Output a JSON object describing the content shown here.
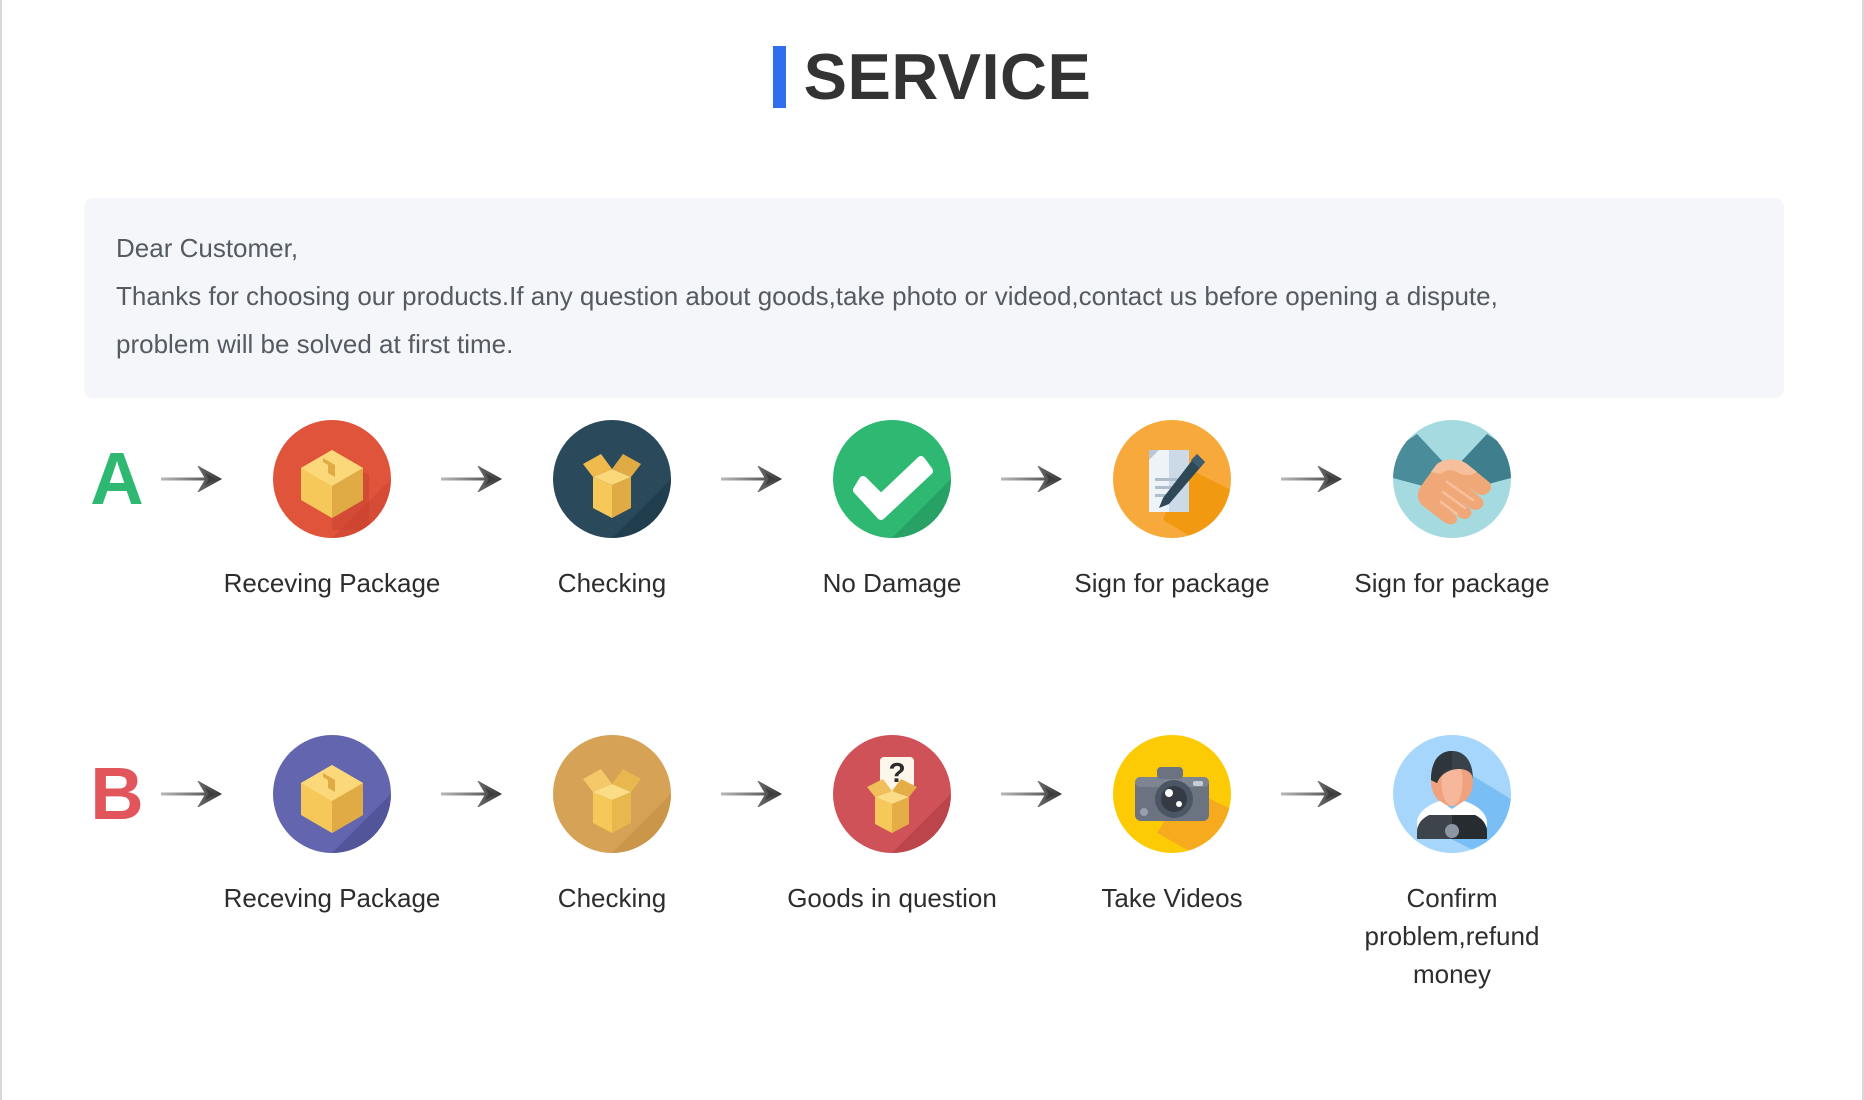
{
  "header": {
    "title": "SERVICE",
    "accent_color": "#2f6fed"
  },
  "notice": {
    "line1": "Dear Customer,",
    "line2": "Thanks for choosing our products.If any question about goods,take photo or videod,contact us before opening a dispute,",
    "line3": "problem will be solved at first time.",
    "background_color": "#f5f6f9"
  },
  "flows": [
    {
      "badge": "A",
      "badge_color": "#2eb872",
      "steps": [
        {
          "label": "Receving Package",
          "icon": "closed-box-icon",
          "circle_color": "#e0543c"
        },
        {
          "label": "Checking",
          "icon": "open-box-icon",
          "circle_color": "#2a4a5c"
        },
        {
          "label": "No Damage",
          "icon": "check-mark-icon",
          "circle_color": "#2eb872"
        },
        {
          "label": "Sign for package",
          "icon": "document-pen-icon",
          "circle_color": "#f7a93b"
        },
        {
          "label": "Sign for package",
          "icon": "handshake-icon",
          "circle_color": "#a5dbe0"
        }
      ]
    },
    {
      "badge": "B",
      "badge_color": "#e2555a",
      "steps": [
        {
          "label": "Receving Package",
          "icon": "closed-box-icon",
          "circle_color": "#6366ae"
        },
        {
          "label": "Checking",
          "icon": "open-box-icon",
          "circle_color": "#d6a256"
        },
        {
          "label": "Goods in question",
          "icon": "question-box-icon",
          "circle_color": "#cf5258"
        },
        {
          "label": "Take Videos",
          "icon": "camera-icon",
          "circle_color": "#fdcb06"
        },
        {
          "label": "Confirm problem,refund money",
          "icon": "support-agent-icon",
          "circle_color": "#a6d6fb"
        }
      ]
    }
  ],
  "arrow": {
    "name": "arrow-right-icon",
    "color": "#4a4a4a"
  }
}
